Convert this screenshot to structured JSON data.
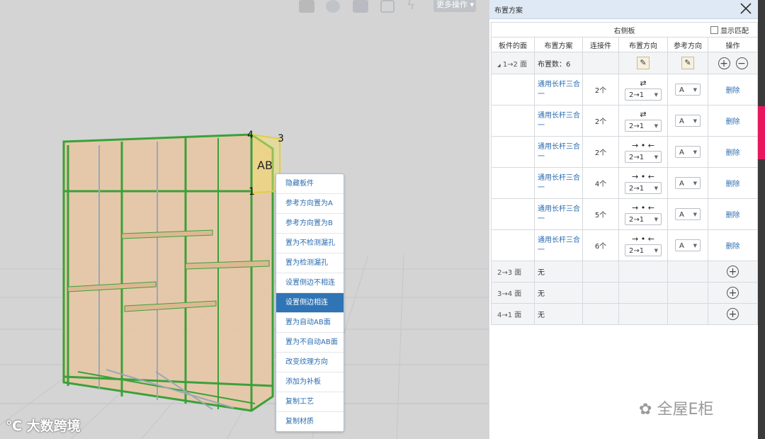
{
  "toolbar": {
    "more_ops_label": "更多操作",
    "icons": [
      "storage-icon",
      "target-icon",
      "copy-icon",
      "fullscreen-icon",
      "lightning-icon"
    ]
  },
  "viewport": {
    "label_ab": "AB",
    "vertex_labels": [
      "4",
      "3",
      "1"
    ],
    "watermark_left": "大数跨境"
  },
  "context_menu": {
    "items": [
      "隐藏板件",
      "参考方向置为A",
      "参考方向置为B",
      "置为不检测漏孔",
      "置为检测漏孔",
      "设置侧边不相连",
      "设置侧边相连",
      "置为自动AB面",
      "置为不自动AB面",
      "改变纹理方向",
      "添加为补板",
      "复制工艺",
      "复制材质"
    ],
    "selected_index": 6
  },
  "panel": {
    "title": "布置方案",
    "section_title": "右侧板",
    "show_match_label": "显示匹配",
    "show_match_checked": false,
    "headers": [
      "板件的面",
      "布置方案",
      "连接件",
      "布置方向",
      "参考方向",
      "操作"
    ],
    "group": {
      "face": "1→2 面",
      "count_label": "布置数：6"
    },
    "rows": [
      {
        "scheme": "通用长杆三合一",
        "count": "2个",
        "arrow": "⇄",
        "direction": "2→1",
        "ref": "A",
        "action": "删除"
      },
      {
        "scheme": "通用长杆三合一",
        "count": "2个",
        "arrow": "⇄",
        "direction": "2→1",
        "ref": "A",
        "action": "删除"
      },
      {
        "scheme": "通用长杆三合一",
        "count": "2个",
        "arrow": "→ • ←",
        "direction": "2→1",
        "ref": "A",
        "action": "删除"
      },
      {
        "scheme": "通用长杆三合一",
        "count": "4个",
        "arrow": "→ • ←",
        "direction": "2→1",
        "ref": "A",
        "action": "删除"
      },
      {
        "scheme": "通用长杆三合一",
        "count": "5个",
        "arrow": "→ • ←",
        "direction": "2→1",
        "ref": "A",
        "action": "删除"
      },
      {
        "scheme": "通用长杆三合一",
        "count": "6个",
        "arrow": "→ • ←",
        "direction": "2→1",
        "ref": "A",
        "action": "删除"
      }
    ],
    "other_faces": [
      {
        "face": "2→3 面",
        "value": "无"
      },
      {
        "face": "3→4 面",
        "value": "无"
      },
      {
        "face": "4→1 面",
        "value": "无"
      }
    ]
  },
  "watermark_right": "全屋E柜",
  "colors": {
    "accent": "#2f74b5",
    "link": "#2b6cb0",
    "panel_header": "#dfe9f5",
    "cabinet_edge": "#3aa13a",
    "cabinet_fill": "#e9c9a6"
  }
}
